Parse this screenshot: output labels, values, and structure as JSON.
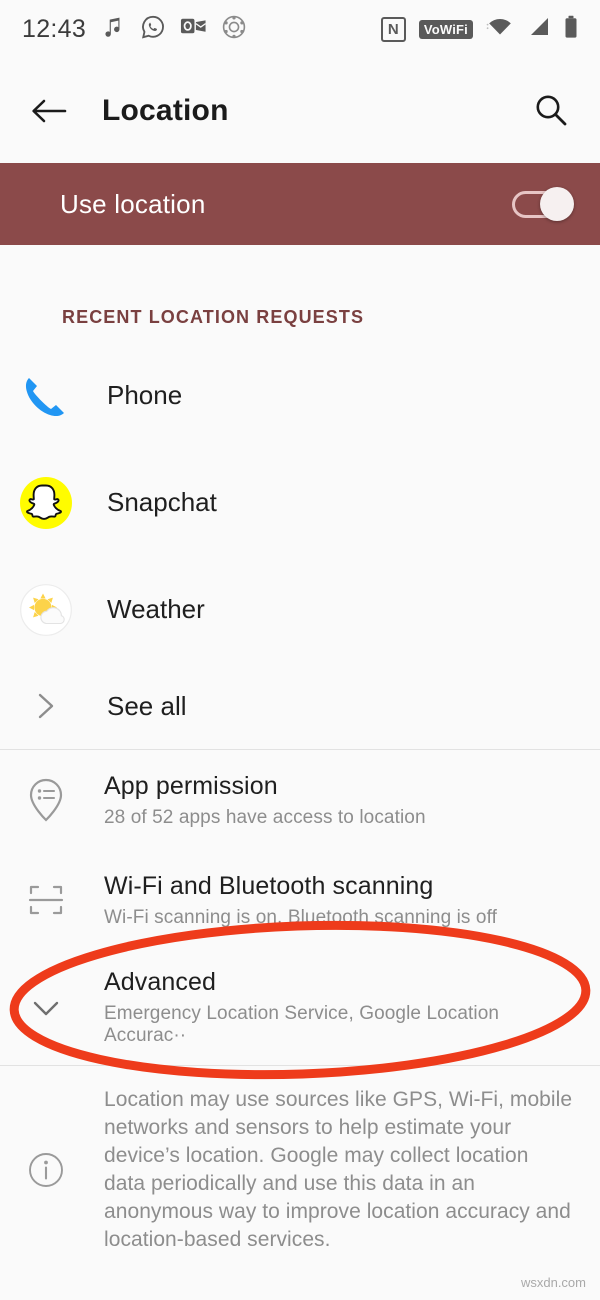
{
  "status_bar": {
    "time": "12:43",
    "left_icons": [
      "music-note-icon",
      "whatsapp-icon",
      "outlook-icon",
      "settings-ball-icon"
    ],
    "right_icons": [
      "nfc-icon",
      "vowifi-badge",
      "wifi-icon",
      "cellular-signal-icon",
      "battery-icon"
    ],
    "nfc_label": "N",
    "vowifi_label": "VoWiFi"
  },
  "app_bar": {
    "back_icon": "arrow-left-icon",
    "title": "Location",
    "search_icon": "search-icon"
  },
  "banner": {
    "label": "Use location",
    "toggle_state": "on",
    "background_color": "#8b4a4a"
  },
  "section": {
    "header": "RECENT LOCATION REQUESTS",
    "header_color": "#7a4040"
  },
  "recent_apps": [
    {
      "name": "Phone",
      "icon": "phone-icon"
    },
    {
      "name": "Snapchat",
      "icon": "snapchat-icon"
    },
    {
      "name": "Weather",
      "icon": "weather-icon"
    }
  ],
  "see_all": {
    "label": "See all",
    "icon": "chevron-right-icon"
  },
  "settings": [
    {
      "title": "App permission",
      "subtitle": "28 of 52 apps have access to location",
      "icon": "location-pin-list-icon"
    },
    {
      "title": "Wi-Fi and Bluetooth scanning",
      "subtitle": "Wi-Fi scanning is on, Bluetooth scanning is off",
      "icon": "scan-frame-icon"
    },
    {
      "title": "Advanced",
      "subtitle": "Emergency Location Service, Google Location Accurac··",
      "icon": "chevron-down-icon"
    }
  ],
  "footer": {
    "icon": "info-icon",
    "text": "Location may use sources like GPS, Wi-Fi, mobile networks and sensors to help estimate your device’s location. Google may collect location data periodically and use this data in an anonymous way to improve location accuracy and location-based services."
  },
  "annotation": {
    "shape": "ellipse",
    "color": "#ee3b1b",
    "targets": "Advanced"
  },
  "watermark": "wsxdn.com"
}
